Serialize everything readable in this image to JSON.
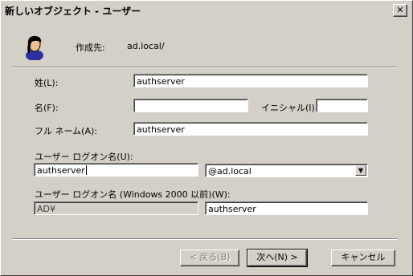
{
  "window": {
    "title": "新しいオブジェクト - ユーザー",
    "close_glyph": "✕"
  },
  "header": {
    "created_in_label": "作成先:",
    "created_in_value": "ad.local/",
    "avatar_icon": "user-icon"
  },
  "form": {
    "last_name_label": "姓(L):",
    "last_name_value": "authserver",
    "first_name_label": "名(F):",
    "first_name_value": "",
    "initials_label": "イニシャル(I):",
    "initials_value": "",
    "full_name_label": "フル ネーム(A):",
    "full_name_value": "authserver",
    "logon_name_label": "ユーザー ログオン名(U):",
    "logon_name_value": "authserver",
    "domain_select_value": "@ad.local",
    "pre2000_label": "ユーザー ログオン名 (Windows 2000 以前)(W):",
    "pre2000_domain_value": "AD¥",
    "pre2000_name_value": "authserver"
  },
  "buttons": {
    "back": "< 戻る(B)",
    "next": "次へ(N) >",
    "cancel": "キャンセル"
  }
}
